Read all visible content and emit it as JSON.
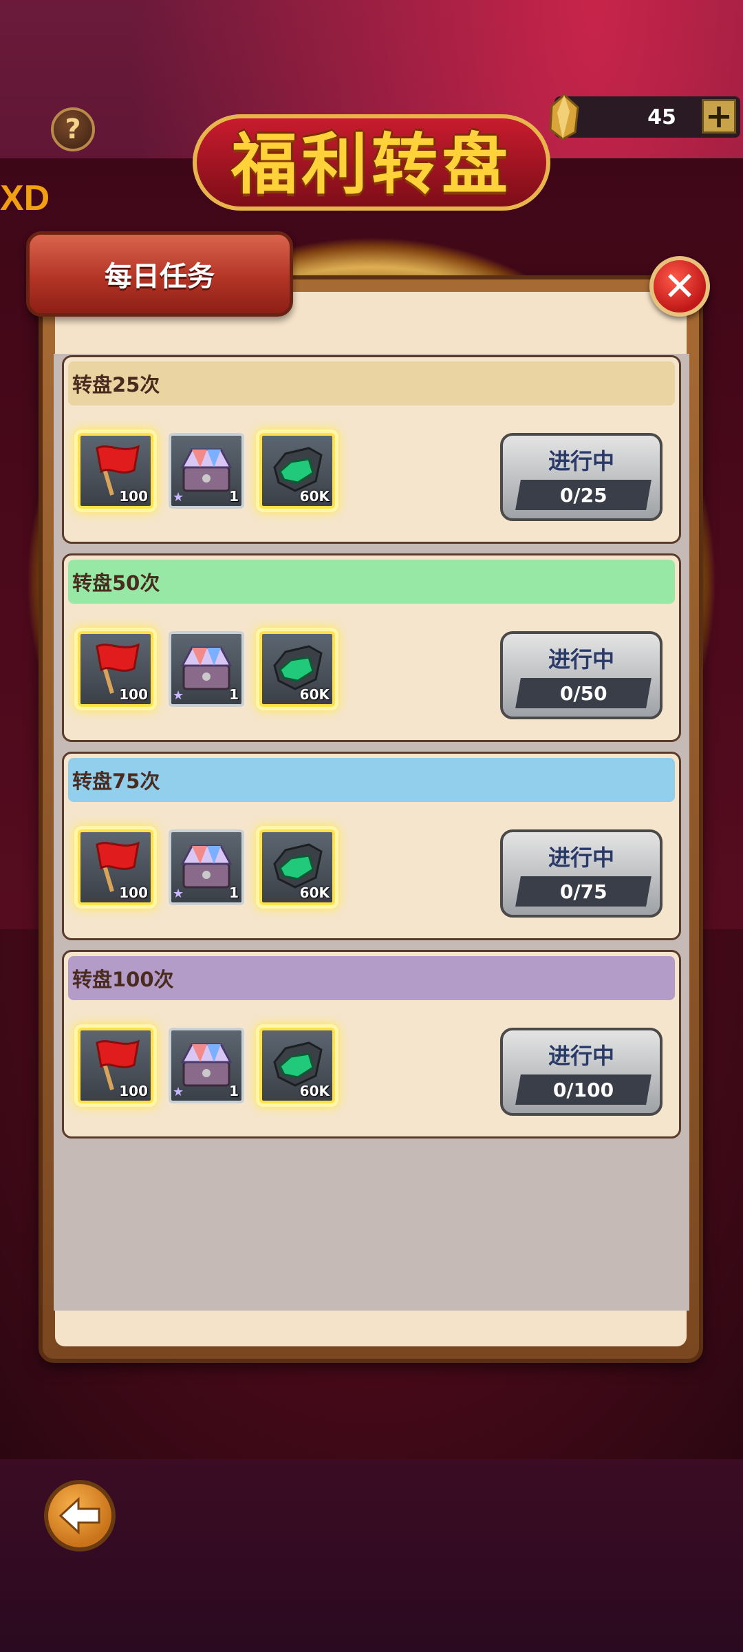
{
  "header": {
    "help_label": "?",
    "partial_text": "XD",
    "title": "福利转盘",
    "currency": {
      "icon": "gold-crystal-icon",
      "value": "45",
      "plus_label": "+"
    }
  },
  "panel": {
    "tab_title": "每日任务",
    "close_label": "✕"
  },
  "tasks": [
    {
      "title": "转盘25次",
      "strip_color": "#ead4a2",
      "status": "进行中",
      "progress": "0/25",
      "rewards": [
        {
          "icon": "red-flag-icon",
          "count": "100"
        },
        {
          "icon": "gem-chest-icon",
          "count": "1"
        },
        {
          "icon": "green-armor-icon",
          "count": "60K"
        }
      ]
    },
    {
      "title": "转盘50次",
      "strip_color": "#96e8a4",
      "status": "进行中",
      "progress": "0/50",
      "rewards": [
        {
          "icon": "red-flag-icon",
          "count": "100"
        },
        {
          "icon": "gem-chest-icon",
          "count": "1"
        },
        {
          "icon": "green-armor-icon",
          "count": "60K"
        }
      ]
    },
    {
      "title": "转盘75次",
      "strip_color": "#92cfec",
      "status": "进行中",
      "progress": "0/75",
      "rewards": [
        {
          "icon": "red-flag-icon",
          "count": "100"
        },
        {
          "icon": "gem-chest-icon",
          "count": "1"
        },
        {
          "icon": "green-armor-icon",
          "count": "60K"
        }
      ]
    },
    {
      "title": "转盘100次",
      "strip_color": "#b49cc8",
      "status": "进行中",
      "progress": "0/100",
      "rewards": [
        {
          "icon": "red-flag-icon",
          "count": "100"
        },
        {
          "icon": "gem-chest-icon",
          "count": "1"
        },
        {
          "icon": "green-armor-icon",
          "count": "60K"
        }
      ]
    }
  ],
  "footer": {
    "back_icon": "back-arrow-icon"
  }
}
